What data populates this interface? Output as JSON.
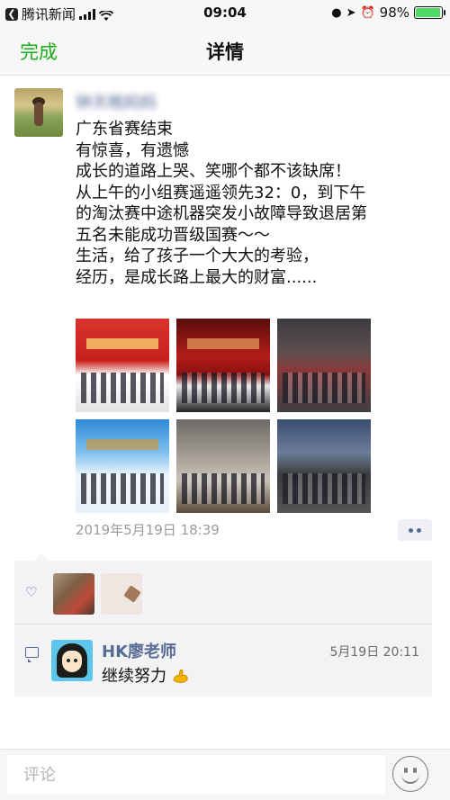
{
  "status_bar": {
    "back_app": "腾讯新闻",
    "time": "09:04",
    "battery": "98%",
    "battery_level": 0.98
  },
  "nav": {
    "done_label": "完成",
    "title": "详情"
  },
  "post": {
    "author": "钟天皓妈妈",
    "lines": [
      "广东省赛结束",
      "有惊喜，有遗憾",
      "成长的道路上哭、笑哪个都不该缺席！",
      "从上午的小组赛遥遥领先32：0，到下午",
      "的淘汰赛中途机器突发小故障导致退居第",
      "五名未能成功晋级国赛～～",
      "生活，给了孩子一个大大的考验，",
      "经历，是成长路上最大的财富......"
    ],
    "photos": [
      "group-photo-stage",
      "award-ceremony-stage",
      "competition-hall",
      "team-with-banner",
      "robot-testing",
      "competition-venue"
    ],
    "timestamp": "2019年5月19日 18:39"
  },
  "likes": {
    "icon": "heart-icon",
    "avatars": [
      "liker-avatar-1",
      "liker-avatar-2"
    ]
  },
  "comments": [
    {
      "name": "HK廖老师",
      "date": "5月19日 20:11",
      "text": "继续努力"
    }
  ],
  "comment_bar": {
    "placeholder": "评论"
  }
}
